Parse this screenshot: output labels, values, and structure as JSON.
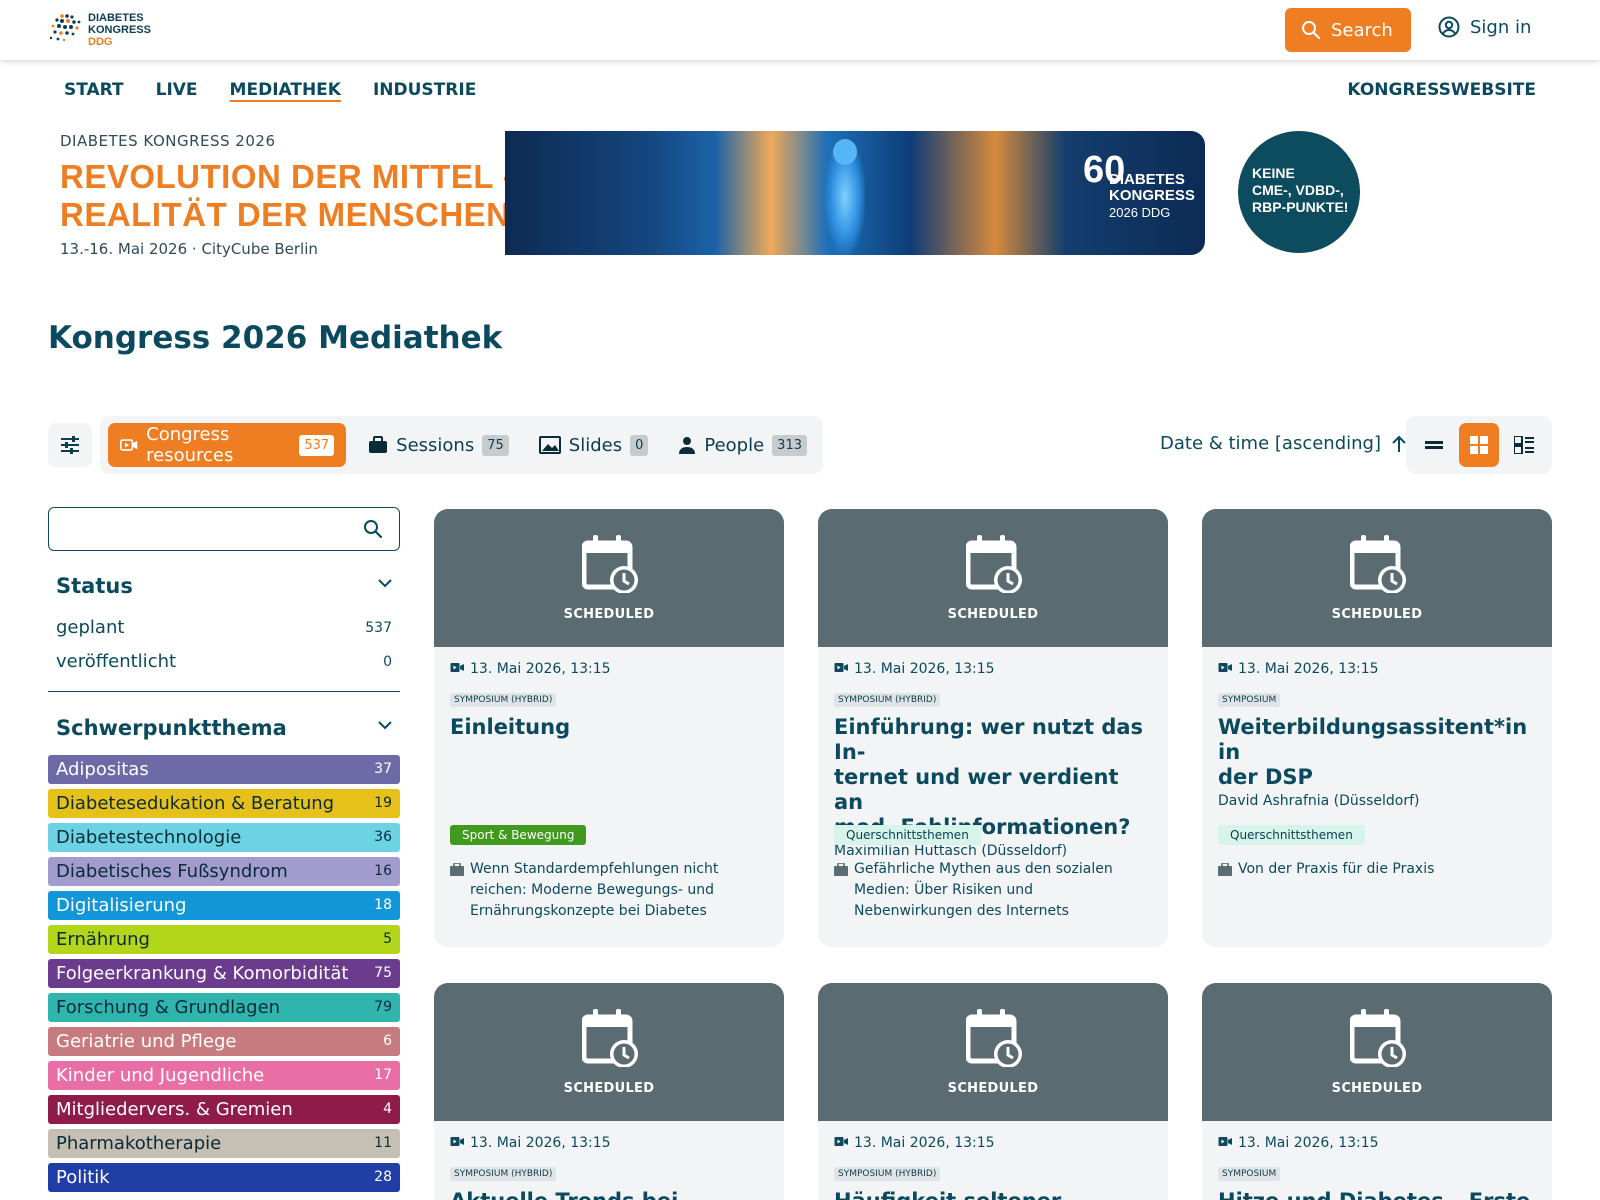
{
  "header": {
    "logo_line1": "DIABETES",
    "logo_line2": "KONGRESS",
    "logo_line3": "DDG",
    "search_label": "Search",
    "signin_label": "Sign in"
  },
  "nav": {
    "items": [
      "START",
      "LIVE",
      "MEDIATHEK",
      "INDUSTRIE"
    ],
    "active": "MEDIATHEK",
    "right": "KONGRESSWEBSITE"
  },
  "banner": {
    "subtitle": "DIABETES KONGRESS 2026",
    "title_line1": "REVOLUTION DER MITTEL –",
    "title_line2": "REALITÄT DER MENSCHEN.",
    "date": "13.-16. Mai 2026 · CityCube Berlin",
    "logo_number": "60",
    "logo_line1": "DIABETES",
    "logo_line2": "KONGRESS",
    "logo_line3": "2026 DDG",
    "badge_line1": "KEINE",
    "badge_line2": "CME-, VDBD-,",
    "badge_line3": "RBP-PUNKTE!"
  },
  "page_title": "Kongress 2026 Mediathek",
  "tabs": [
    {
      "label": "Congress resources",
      "count": "537",
      "icon": "video-icon",
      "active": true
    },
    {
      "label": "Sessions",
      "count": "75",
      "icon": "briefcase-icon",
      "active": false
    },
    {
      "label": "Slides",
      "count": "0",
      "icon": "image-icon",
      "active": false
    },
    {
      "label": "People",
      "count": "313",
      "icon": "person-icon",
      "active": false
    }
  ],
  "sort": {
    "label": "Date & time [ascending]"
  },
  "sidebar": {
    "search_placeholder": "",
    "status": {
      "title": "Status",
      "items": [
        {
          "label": "geplant",
          "count": "537"
        },
        {
          "label": "veröffentlicht",
          "count": "0"
        }
      ]
    },
    "topics": {
      "title": "Schwerpunktthema",
      "items": [
        {
          "label": "Adipositas",
          "count": "37",
          "color": "#6d6aa7",
          "text": "#ffffff"
        },
        {
          "label": "Diabetesedukation & Beratung",
          "count": "19",
          "color": "#e6c11a",
          "text": "#0b2b38"
        },
        {
          "label": "Diabetestechnologie",
          "count": "36",
          "color": "#6bd3e4",
          "text": "#0b2b38"
        },
        {
          "label": "Diabetisches Fußsyndrom",
          "count": "16",
          "color": "#a19ccd",
          "text": "#0b2b38"
        },
        {
          "label": "Digitalisierung",
          "count": "18",
          "color": "#1196d8",
          "text": "#ffffff"
        },
        {
          "label": "Ernährung",
          "count": "5",
          "color": "#b3d51a",
          "text": "#0b2b38"
        },
        {
          "label": "Folgeerkrankung & Komorbidität",
          "count": "75",
          "color": "#6b3b8e",
          "text": "#ffffff"
        },
        {
          "label": "Forschung & Grundlagen",
          "count": "79",
          "color": "#2fb5ad",
          "text": "#0b2b38"
        },
        {
          "label": "Geriatrie und Pflege",
          "count": "6",
          "color": "#c77b7e",
          "text": "#ffffff"
        },
        {
          "label": "Kinder und Jugendliche",
          "count": "17",
          "color": "#e96ea5",
          "text": "#ffffff"
        },
        {
          "label": "Mitgliedervers. & Gremien",
          "count": "4",
          "color": "#8e1b48",
          "text": "#ffffff"
        },
        {
          "label": "Pharmakotherapie",
          "count": "11",
          "color": "#c6bfb4",
          "text": "#0b2b38"
        },
        {
          "label": "Politik",
          "count": "28",
          "color": "#1f3ea6",
          "text": "#ffffff"
        }
      ]
    }
  },
  "cards": [
    {
      "status": "SCHEDULED",
      "date": "13. Mai 2026, 13:15",
      "type": "SYMPOSIUM (HYBRID)",
      "title_lines": [
        "Einleitung"
      ],
      "person": "",
      "tag": "Sport & Bewegung",
      "tag_bg": "#3f9a1e",
      "tag_fg": "#ffffff",
      "session_lines": [
        "Wenn Standardempfehlungen nicht",
        "reichen: Moderne Bewegungs- und",
        "Ernährungskonzepte bei Diabetes"
      ]
    },
    {
      "status": "SCHEDULED",
      "date": "13. Mai 2026, 13:15",
      "type": "SYMPOSIUM (HYBRID)",
      "title_lines": [
        "Einführung: wer nutzt das In-",
        "ternet und wer verdient an",
        "med. Fehlinformationen?"
      ],
      "person": "Maximilian Huttasch (Düsseldorf)",
      "tag": "Querschnittsthemen",
      "tag_bg": "#d7f4ea",
      "tag_fg": "#0b3c50",
      "session_lines": [
        "Gefährliche Mythen aus den sozialen",
        "Medien: Über Risiken und",
        "Nebenwirkungen des Internets"
      ]
    },
    {
      "status": "SCHEDULED",
      "date": "13. Mai 2026, 13:15",
      "type": "SYMPOSIUM",
      "title_lines": [
        "Weiterbildungsassitent*in in",
        "der DSP"
      ],
      "person": "David Ashrafnia (Düsseldorf)",
      "tag": "Querschnittsthemen",
      "tag_bg": "#d7f4ea",
      "tag_fg": "#0b3c50",
      "session_lines": [
        "Von der Praxis für die Praxis"
      ]
    },
    {
      "status": "SCHEDULED",
      "date": "13. Mai 2026, 13:15",
      "type": "SYMPOSIUM (HYBRID)",
      "title_lines": [
        "Aktuelle Trends bei kardiova"
      ]
    },
    {
      "status": "SCHEDULED",
      "date": "13. Mai 2026, 13:15",
      "type": "SYMPOSIUM (HYBRID)",
      "title_lines": [
        "Häufigkeit seltener Diabetes"
      ]
    },
    {
      "status": "SCHEDULED",
      "date": "13. Mai 2026, 13:15",
      "type": "SYMPOSIUM",
      "title_lines": [
        "Hitze und Diabetes – Erste Er"
      ]
    }
  ]
}
